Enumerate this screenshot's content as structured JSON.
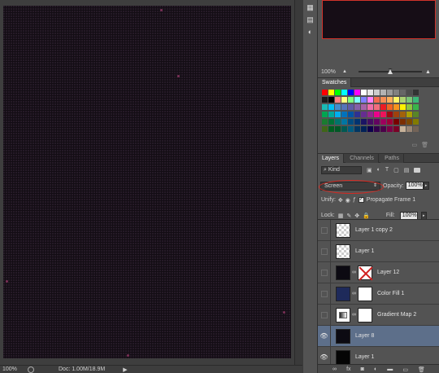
{
  "status": {
    "zoom": "100%",
    "doc": "Doc: 1.00M/18.9M",
    "arrow": "▶"
  },
  "navigator": {
    "zoom": "100%"
  },
  "swatches": {
    "tab_label": "Swatches",
    "colors": [
      "#ff0000",
      "#ffff00",
      "#00ff00",
      "#00ffff",
      "#0000ff",
      "#ff00ff",
      "#ffffff",
      "#e6e6e6",
      "#cccccc",
      "#b3b3b3",
      "#999999",
      "#808080",
      "#666666",
      "#4d4d4d",
      "#333333",
      "#1a1a1a",
      "#000000",
      "#ff8080",
      "#ffff80",
      "#80ff80",
      "#80ffff",
      "#8080ff",
      "#ff80ff",
      "#f26c4f",
      "#f68e55",
      "#fbaf5c",
      "#fff467",
      "#acd372",
      "#7cc576",
      "#3bb878",
      "#1abbb4",
      "#00bff3",
      "#438ccb",
      "#5574b9",
      "#605ca8",
      "#855fa8",
      "#a763a8",
      "#f06ea9",
      "#f26d7d",
      "#ed1c24",
      "#f26522",
      "#f7941d",
      "#fff200",
      "#8dc63f",
      "#39b54a",
      "#00a651",
      "#00a99d",
      "#00aeef",
      "#0072bc",
      "#0054a6",
      "#2e3192",
      "#662d91",
      "#92278f",
      "#ec008c",
      "#ed145b",
      "#9e0b0f",
      "#a0410d",
      "#a3620a",
      "#aba000",
      "#598527",
      "#1a7b30",
      "#007236",
      "#00746b",
      "#0076a3",
      "#004b80",
      "#003471",
      "#1b1464",
      "#440e62",
      "#630460",
      "#9e005d",
      "#9e0039",
      "#790000",
      "#7b2e00",
      "#7d4900",
      "#827b00",
      "#406618",
      "#005e20",
      "#005826",
      "#005952",
      "#005b7f",
      "#003663",
      "#002157",
      "#0d004c",
      "#32004b",
      "#4b0049",
      "#7b0046",
      "#7a0026",
      "#c7b299",
      "#998675",
      "#736357"
    ]
  },
  "layers": {
    "tabs": [
      "Layers",
      "Channels",
      "Paths"
    ],
    "filter_kind": "Kind",
    "blend_mode": "Screen",
    "opacity_label": "Opacity:",
    "opacity_value": "100%",
    "unify_label": "Unify:",
    "propagate_label": "Propagate Frame 1",
    "lock_label": "Lock:",
    "fill_label": "Fill:",
    "fill_value": "100%",
    "items": [
      {
        "name": "Layer 1 copy 2",
        "visible": false,
        "selected": false
      },
      {
        "name": "Layer 1",
        "visible": false,
        "selected": false
      },
      {
        "name": "Layer 12",
        "visible": false,
        "selected": false
      },
      {
        "name": "Color Fill 1",
        "visible": false,
        "selected": false
      },
      {
        "name": "Gradient Map 2",
        "visible": false,
        "selected": false
      },
      {
        "name": "Layer 8",
        "visible": true,
        "selected": true
      },
      {
        "name": "Layer 1",
        "visible": true,
        "selected": false
      }
    ]
  }
}
